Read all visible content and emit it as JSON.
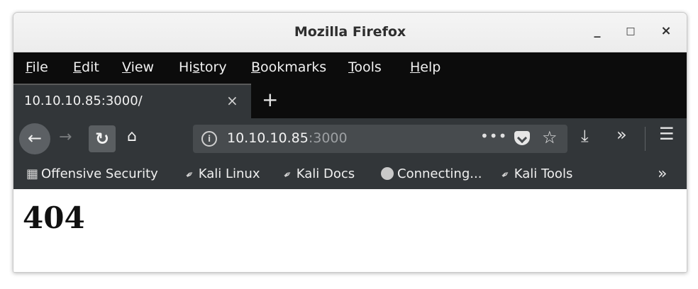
{
  "window": {
    "title": "Mozilla Firefox",
    "minimize_glyph": "_",
    "maximize_glyph": "□",
    "close_glyph": "×"
  },
  "menu": {
    "items": [
      {
        "pre": "",
        "ul": "F",
        "post": "ile"
      },
      {
        "pre": "",
        "ul": "E",
        "post": "dit"
      },
      {
        "pre": "",
        "ul": "V",
        "post": "iew"
      },
      {
        "pre": "Hi",
        "ul": "s",
        "post": "tory"
      },
      {
        "pre": "",
        "ul": "B",
        "post": "ookmarks"
      },
      {
        "pre": "",
        "ul": "T",
        "post": "ools"
      },
      {
        "pre": "",
        "ul": "H",
        "post": "elp"
      }
    ]
  },
  "tab": {
    "title": "10.10.10.85:3000/",
    "close_glyph": "×",
    "new_tab_glyph": "+"
  },
  "navbar": {
    "url_host": "10.10.10.85",
    "url_port": ":3000",
    "page_actions_glyph": "•••",
    "icons": {
      "back": "back-arrow-icon",
      "forward": "forward-arrow-icon",
      "reload": "reload-icon",
      "home": "home-icon",
      "info": "info-icon",
      "pocket": "pocket-icon",
      "star": "star-icon",
      "download": "download-icon",
      "overflow": "overflow-chevron-icon",
      "menu": "hamburger-menu-icon"
    }
  },
  "bookmarks": {
    "items": [
      {
        "label": "Offensive Security",
        "icon": "offsec-icon"
      },
      {
        "label": "Kali Linux",
        "icon": "kali-dragon-icon"
      },
      {
        "label": "Kali Docs",
        "icon": "kali-dragon-icon"
      },
      {
        "label": "Connecting...",
        "icon": "globe-icon"
      },
      {
        "label": "Kali Tools",
        "icon": "kali-dragon-icon"
      }
    ],
    "more_glyph": "»"
  },
  "page": {
    "heading": "404"
  }
}
